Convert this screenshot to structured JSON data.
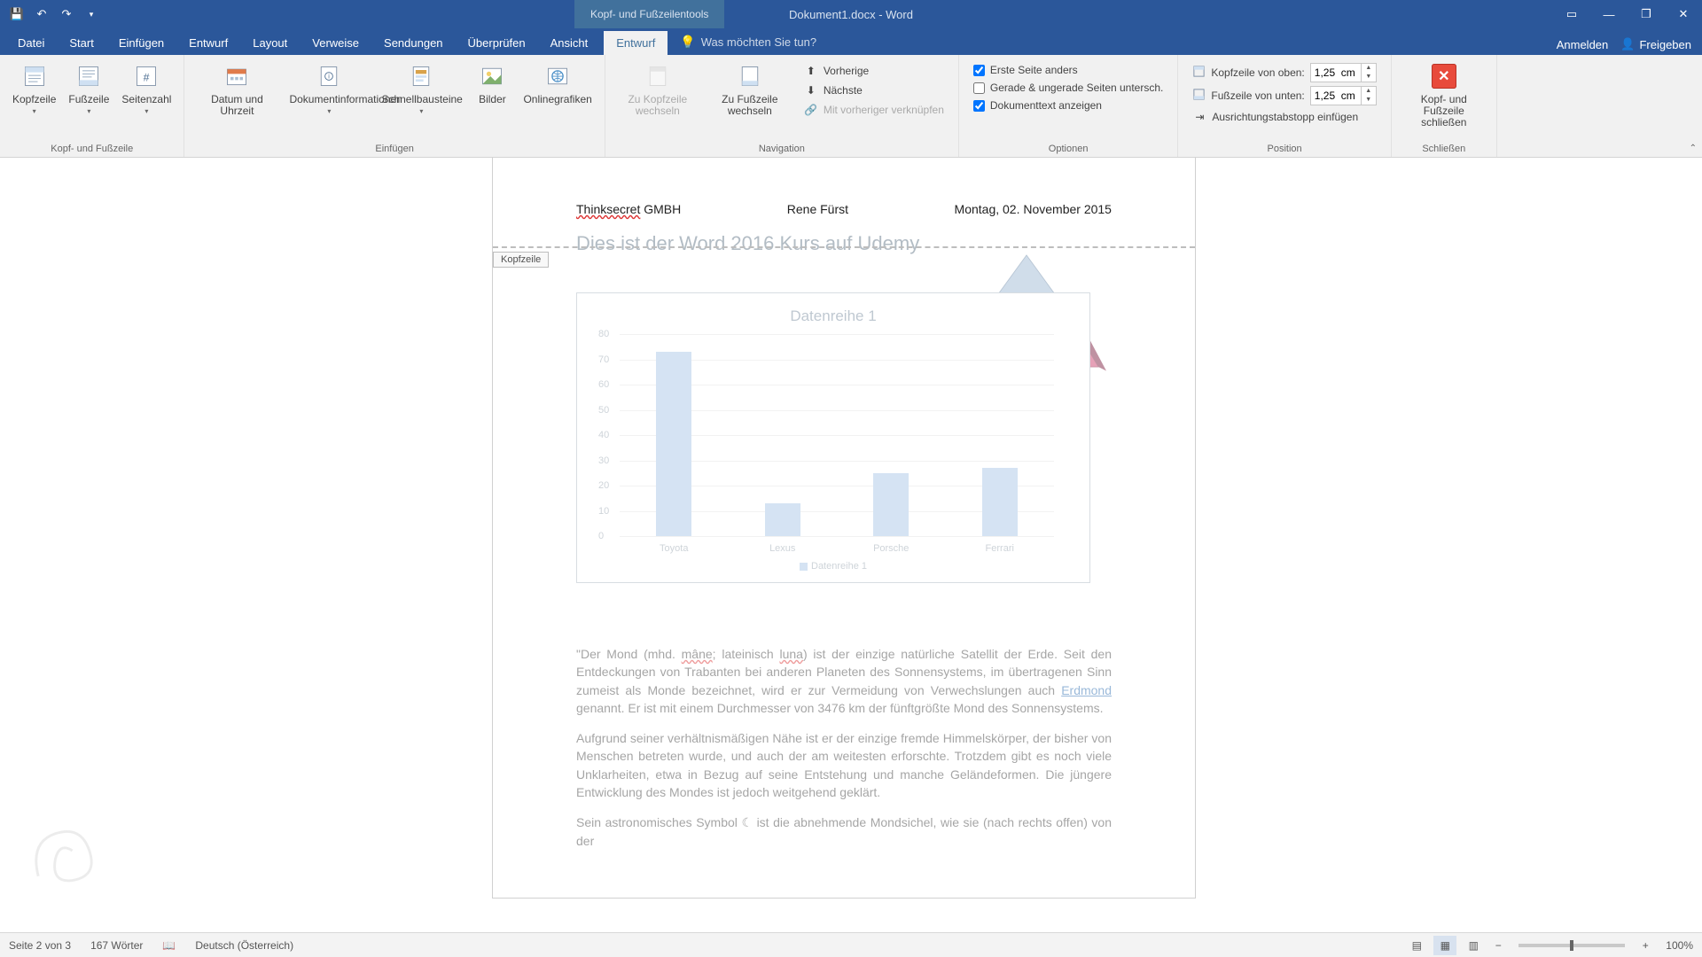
{
  "title_bar": {
    "contextual_label": "Kopf- und Fußzeilentools",
    "document_title": "Dokument1.docx - Word"
  },
  "tabs": {
    "items": [
      "Datei",
      "Start",
      "Einfügen",
      "Entwurf",
      "Layout",
      "Verweise",
      "Sendungen",
      "Überprüfen",
      "Ansicht"
    ],
    "contextual": "Entwurf",
    "tell_me_placeholder": "Was möchten Sie tun?",
    "sign_in": "Anmelden",
    "share": "Freigeben"
  },
  "ribbon": {
    "group_hf": {
      "label": "Kopf- und Fußzeile",
      "kopfzeile": "Kopfzeile",
      "fusszeile": "Fußzeile",
      "seitenzahl": "Seitenzahl"
    },
    "group_insert": {
      "label": "Einfügen",
      "datum": "Datum und Uhrzeit",
      "docinfo": "Dokumentinformationen",
      "schnell": "Schnellbausteine",
      "bilder": "Bilder",
      "online": "Onlinegrafiken"
    },
    "group_nav": {
      "label": "Navigation",
      "zu_kopf": "Zu Kopfzeile wechseln",
      "zu_fuss": "Zu Fußzeile wechseln",
      "vorherige": "Vorherige",
      "naechste": "Nächste",
      "verknuepfen": "Mit vorheriger verknüpfen"
    },
    "group_options": {
      "label": "Optionen",
      "erste_seite": "Erste Seite anders",
      "gerade": "Gerade & ungerade Seiten untersch.",
      "doktext": "Dokumenttext anzeigen"
    },
    "group_position": {
      "label": "Position",
      "kopf_von_oben": "Kopfzeile von oben:",
      "fuss_von_unten": "Fußzeile von unten:",
      "oben_val": "1,25  cm",
      "unten_val": "1,25  cm",
      "tabstopp": "Ausrichtungstabstopp einfügen"
    },
    "group_close": {
      "label": "Schließen",
      "close_btn": "Kopf- und Fußzeile schließen"
    }
  },
  "options_state": {
    "erste_seite": true,
    "gerade": false,
    "doktext": true
  },
  "page": {
    "hf_tag": "Kopfzeile",
    "header_left_underlined": "Thinksecret",
    "header_left_rest": " GMBH",
    "header_center": "Rene Fürst",
    "header_right": "Montag, 02. November 2015",
    "heading": "Dies ist der Word 2016 Kurs auf Udemy",
    "para1_a": "\"Der Mond (mhd. ",
    "para1_b": "mâne",
    "para1_c": "; lateinisch ",
    "para1_d": "luna",
    "para1_e": ") ist der einzige natürliche Satellit der Erde. Seit den Entdeckungen von Trabanten bei anderen Planeten des Sonnensystems, im übertragenen Sinn zumeist als Monde bezeichnet, wird er zur Vermeidung von Verwechslungen auch ",
    "para1_f": "Erdmond",
    "para1_g": " genannt. Er ist mit einem Durchmesser von 3476 km der fünftgrößte Mond des Sonnensystems.",
    "para2": "Aufgrund seiner verhältnismäßigen Nähe ist er der einzige fremde Himmelskörper, der bisher von Menschen betreten wurde, und auch der am weitesten erforschte. Trotzdem gibt es noch viele Unklarheiten, etwa in Bezug auf seine Entstehung und manche Geländeformen. Die jüngere Entwicklung des Mondes ist jedoch weitgehend geklärt.",
    "para3": "Sein astronomisches Symbol ☾ ist die abnehmende Mondsichel, wie sie (nach rechts offen) von der"
  },
  "chart_data": {
    "type": "bar",
    "title": "Datenreihe 1",
    "categories": [
      "Toyota",
      "Lexus",
      "Porsche",
      "Ferrari"
    ],
    "values": [
      73,
      13,
      25,
      27
    ],
    "ylim": [
      0,
      80
    ],
    "yticks": [
      0,
      10,
      20,
      30,
      40,
      50,
      60,
      70,
      80
    ],
    "legend": "Datenreihe 1"
  },
  "statusbar": {
    "page": "Seite 2 von 3",
    "words": "167 Wörter",
    "lang": "Deutsch (Österreich)",
    "zoom": "100%"
  }
}
